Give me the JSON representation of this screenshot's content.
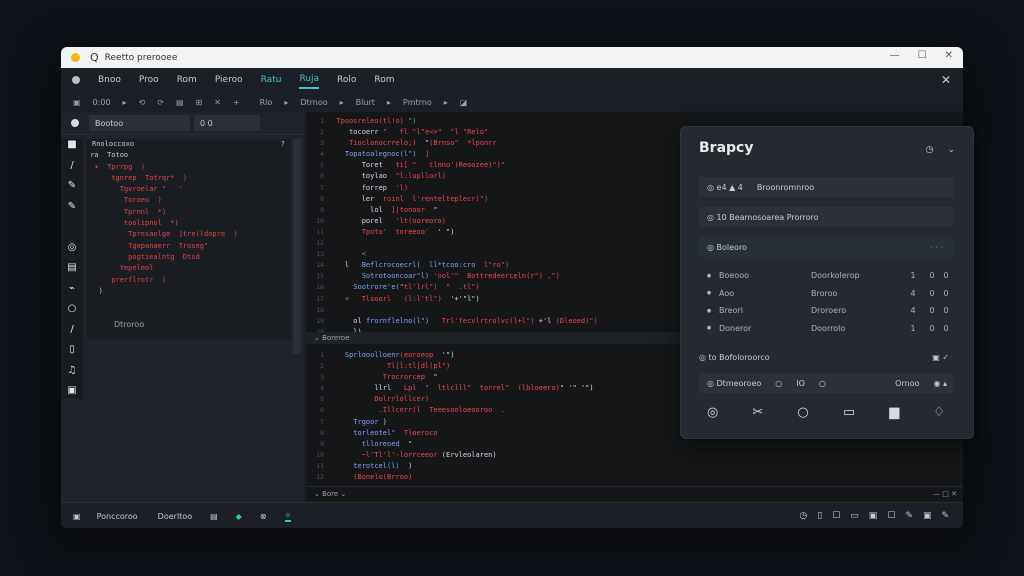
{
  "titlebar": {
    "search_glyph": "Q",
    "title": "Reetto prerooee",
    "controls": [
      "—",
      "☐",
      "✕"
    ]
  },
  "menu": {
    "items": [
      "Bnoo",
      "Proo",
      "Rom",
      "Pieroo",
      "Ratu",
      "Ruja",
      "Rolo",
      "Rom"
    ],
    "close": "✕"
  },
  "toolbar": {
    "items": [
      "▣",
      "0:00",
      "▸",
      "⟲",
      "⟳",
      "▤",
      "⊞",
      "✕",
      "+",
      "Rlo",
      "▸",
      "Dtrnoo",
      "▸",
      "Blurt",
      "▸",
      "Pmtrno",
      "▸",
      "◪"
    ]
  },
  "sidebar": {
    "field_value": "Bootoo",
    "field2_value": "0  0",
    "rail_icons": [
      "■",
      "/",
      "✎",
      "✎",
      "",
      "◎",
      "▤",
      "⌁",
      "○",
      "/",
      "▯",
      "♫",
      "▣"
    ],
    "tree_head": [
      "Rnoloccoxo",
      "?"
    ],
    "tree_lines": [
      {
        "t": " ra  Totoo",
        "w": true
      },
      {
        "t": "  ▾  Tprrpg  )",
        "w": false
      },
      {
        "t": "      tgnrep  Totrqr*  )",
        "w": false
      },
      {
        "t": "        Tgvroelar \"   '",
        "w": false
      },
      {
        "t": "         Toroeo  )",
        "w": false
      },
      {
        "t": "         Tprnnl  *)",
        "w": false
      },
      {
        "t": "         toolipnol  *)",
        "w": false
      },
      {
        "t": "          Tpresaolge  ]tre(ldopre  )",
        "w": false
      },
      {
        "t": "          Tgepanaerr  Troseg\"",
        "w": false
      },
      {
        "t": "          pogtiealntg  Dtsd",
        "w": false
      },
      {
        "t": "        Yepeleol",
        "w": false
      },
      {
        "t": "      prerflrotr  )",
        "w": false
      },
      {
        "t": "   )",
        "w": true
      }
    ],
    "bottom_label": "Dtroroo",
    "bottom_chevron": ">"
  },
  "editor": {
    "top_lines": [
      [
        [
          "gr",
          "  "
        ],
        [
          "red",
          "Tpoosreleo(tl!o)"
        ],
        [
          "gr",
          " \")"
        ]
      ],
      [
        [
          "wh",
          "     tocoerr "
        ],
        [
          "red",
          "\"   fl \"l\"e<>\"  \"l "
        ],
        [
          "red",
          "\"Relo\""
        ]
      ],
      [
        [
          "red",
          "     Tioclonocrrelo;)"
        ],
        [
          "wh",
          "  \""
        ],
        [
          "red",
          "(Brnso\"  *lponrr"
        ]
      ],
      [
        [
          "blue",
          "    Topatoalegnoc(l\")  "
        ],
        [
          "red",
          "]"
        ]
      ],
      [
        [
          "wh",
          "        Toret   "
        ],
        [
          "red",
          "ti[ \"   tlnno'(Reoozee)\")\""
        ]
      ],
      [
        [
          "wh",
          "        toylao  "
        ],
        [
          "red",
          "\"l:lupllorl)"
        ]
      ],
      [
        [
          "wh",
          "        forrep  "
        ],
        [
          "red",
          "'l)"
        ]
      ],
      [
        [
          "wh",
          "        ler  "
        ],
        [
          "red",
          "roinl  l'"
        ],
        [
          "red",
          "rentelteplecr)\")"
        ]
      ],
      [
        [
          "wh",
          "          lol  "
        ],
        [
          "red",
          "]|tonoor  "
        ],
        [
          "wh",
          "\""
        ]
      ],
      [
        [
          "wh",
          "        porel   "
        ],
        [
          "red",
          "'lt(ooreoro)"
        ]
      ],
      [
        [
          "red",
          "        Tpoto'  toreeoo'"
        ],
        [
          "wh",
          "  ' \")"
        ]
      ],
      [
        [
          "gr",
          ""
        ]
      ],
      [
        [
          "gr",
          "        <"
        ]
      ],
      [
        [
          "wh",
          "    l   "
        ],
        [
          "blue",
          "Beflcrocoecrl(  ll*tcoo:cro  "
        ],
        [
          "red",
          "l\"ro\")"
        ]
      ],
      [
        [
          "blue",
          "        Sotrotooncoar\"l) "
        ],
        [
          "red",
          "'ool'\"  "
        ],
        [
          "red",
          "Bottredeerceln(r\") ,\")"
        ]
      ],
      [
        [
          "blue",
          "      Sootrore'e(\""
        ],
        [
          "red",
          "tl'lrl\")  \"  ."
        ],
        [
          "red",
          "tl\")"
        ]
      ],
      [
        [
          "red",
          "    +   Tlsoorl   (l:l'tl\")  "
        ],
        [
          "wh",
          "'+'\"l\")"
        ]
      ],
      [
        [
          "gr",
          ""
        ]
      ],
      [
        [
          "wh",
          "      ol "
        ],
        [
          "blue",
          "frornflelno(l\")"
        ],
        [
          "red",
          "   Trl'fecvlrtrolvc(l+l\")"
        ],
        [
          "wh",
          " +'l "
        ],
        [
          "red",
          "(Dleoed)\")"
        ]
      ],
      [
        [
          "wh",
          "      l)"
        ]
      ]
    ],
    "pane_label": "⌄  Boreroe",
    "bottom_lines": [
      [
        [
          "blue",
          "    Sprlooolloenr"
        ],
        [
          "red",
          "(eoroeop"
        ],
        [
          "wh",
          "  '\")"
        ]
      ],
      [
        [
          "red",
          "              Tl[l:tl[dl(pl\")"
        ]
      ],
      [
        [
          "red",
          "             Trocrorcep"
        ],
        [
          "wh",
          "  \""
        ]
      ],
      [
        [
          "wh",
          "           llrl   "
        ],
        [
          "red",
          "Lpl"
        ],
        [
          "wh",
          "  '  "
        ],
        [
          "red",
          "ltlclll\"  "
        ],
        [
          "red",
          "torrel\"  (lbloeero)"
        ],
        [
          "wh",
          "\" '\" '\")"
        ]
      ],
      [
        [
          "red",
          "           Dolrrlollcer)"
        ]
      ],
      [
        [
          "red",
          "            .Illcerr(l  Teeesooloeooroo  ."
        ]
      ],
      [
        [
          "blue",
          "      Trgoor"
        ],
        [
          "wh",
          " )"
        ]
      ],
      [
        [
          "blue",
          "      torleotel\"  "
        ],
        [
          "red",
          "Tloeroco"
        ]
      ],
      [
        [
          "wh",
          "        "
        ],
        [
          "blue",
          "tlloreoed"
        ],
        [
          "wh",
          "  \""
        ]
      ],
      [
        [
          "wh",
          "        "
        ],
        [
          "red",
          "~l'Tl'l'"
        ],
        [
          "red",
          "-lorrceeor"
        ],
        [
          "wh",
          " (Ervleolaren)"
        ]
      ],
      [
        [
          "blue",
          "      terotcel(l)"
        ],
        [
          "wh",
          "  )"
        ]
      ],
      [
        [
          "red",
          "      (Bonelo(Brroo)"
        ]
      ]
    ],
    "bottom_bar": "⌄  Bore   ⌄",
    "bottom_controls": "—  □  ✕"
  },
  "statusbar": {
    "home_icon": "▣",
    "items": [
      "Ponccoroo",
      "Doerltoo",
      "▤",
      "◆",
      "⊗",
      "✧"
    ],
    "right_icons": [
      "◷",
      "▯",
      "☐",
      "▭",
      "▣",
      "☐",
      "✎",
      "▣",
      "✎"
    ]
  },
  "panel": {
    "title": "Brapcy",
    "controls": [
      "◷",
      "⌄"
    ],
    "row1": [
      "◎  e4  ▲ 4",
      "Broonromnroo"
    ],
    "row2": [
      "◎  10  Beamosoarea   Prorroro"
    ],
    "row3": [
      "◎  Boleoro",
      "·  ·  ·"
    ],
    "table": [
      [
        "●",
        "Boeooo",
        "Doorkolerop",
        "1",
        "0",
        "0"
      ],
      [
        "●",
        "Aoo",
        "Broroo",
        "4",
        "0",
        "0"
      ],
      [
        "●",
        "Breorl",
        "Droroero",
        "4",
        "0",
        "0"
      ],
      [
        "●",
        "Doneror",
        "Doorrolo",
        "1",
        "0",
        "0"
      ]
    ],
    "row4": [
      "◎  to  Bofoloroorco",
      "▣   ✓"
    ],
    "row5": [
      "◎  Dtmeoroeo",
      "○",
      "IO",
      "○",
      "Ornoo",
      "◉  ▴"
    ],
    "icons": [
      "◎",
      "✂",
      "○",
      "▭",
      "▆",
      "♢"
    ]
  }
}
